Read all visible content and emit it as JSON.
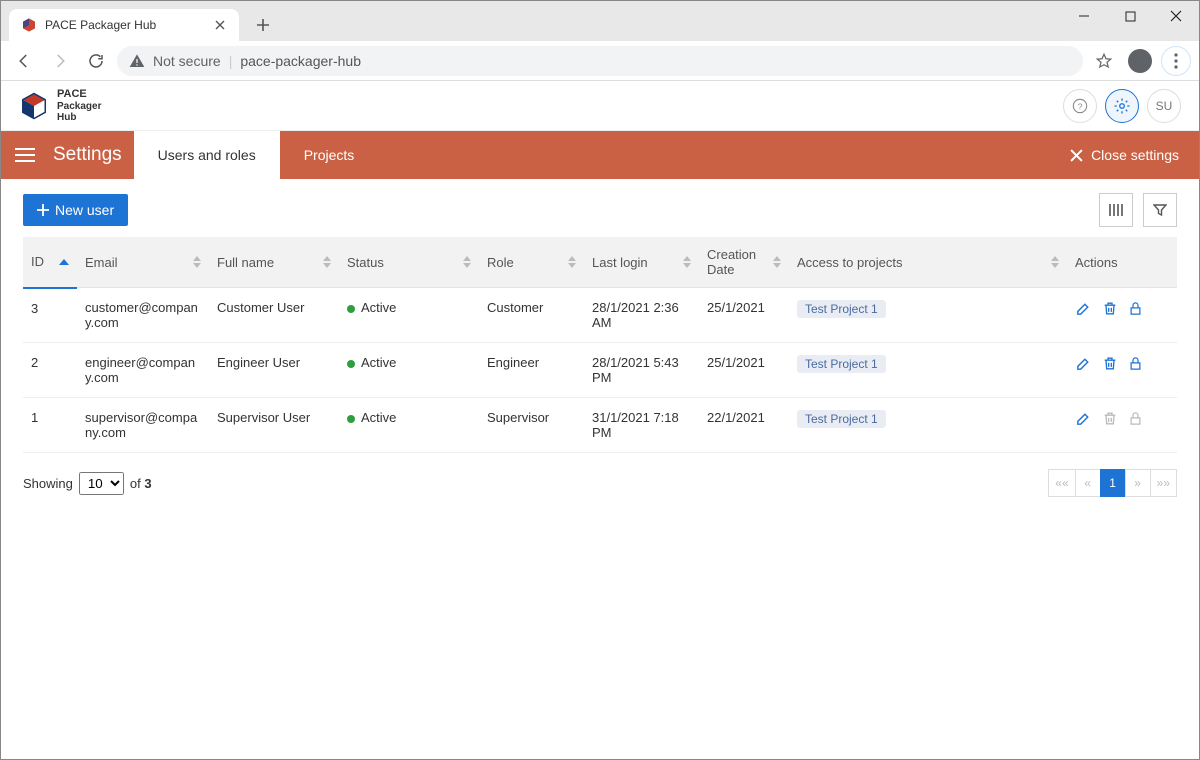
{
  "browser": {
    "tab_title": "PACE Packager Hub",
    "not_secure": "Not secure",
    "url": "pace-packager-hub"
  },
  "app_header": {
    "brand_line1": "PACE",
    "brand_line2": "Packager",
    "brand_line3": "Hub",
    "user_initials": "SU"
  },
  "orange": {
    "title": "Settings",
    "tab_users": "Users and roles",
    "tab_projects": "Projects",
    "close": "Close settings"
  },
  "toolbar": {
    "new_user": "New user"
  },
  "columns": {
    "id": "ID",
    "email": "Email",
    "full_name": "Full name",
    "status": "Status",
    "role": "Role",
    "last_login": "Last login",
    "creation_date": "Creation Date",
    "access": "Access to projects",
    "actions": "Actions"
  },
  "rows": [
    {
      "id": "3",
      "email": "customer@company.com",
      "full_name": "Customer User",
      "status": "Active",
      "role": "Customer",
      "last_login": "28/1/2021 2:36 AM",
      "creation_date": "25/1/2021",
      "project": "Test Project 1",
      "lock_disabled": false,
      "delete_disabled": false
    },
    {
      "id": "2",
      "email": "engineer@company.com",
      "full_name": "Engineer User",
      "status": "Active",
      "role": "Engineer",
      "last_login": "28/1/2021 5:43 PM",
      "creation_date": "25/1/2021",
      "project": "Test Project 1",
      "lock_disabled": false,
      "delete_disabled": false
    },
    {
      "id": "1",
      "email": "supervisor@company.com",
      "full_name": "Supervisor User",
      "status": "Active",
      "role": "Supervisor",
      "last_login": "31/1/2021 7:18 PM",
      "creation_date": "22/1/2021",
      "project": "Test Project 1",
      "lock_disabled": true,
      "delete_disabled": true
    }
  ],
  "footer": {
    "showing": "Showing",
    "of": "of",
    "total": "3",
    "page_size": "10",
    "first": "««",
    "prev": "«",
    "current": "1",
    "next": "»",
    "last": "»»"
  }
}
